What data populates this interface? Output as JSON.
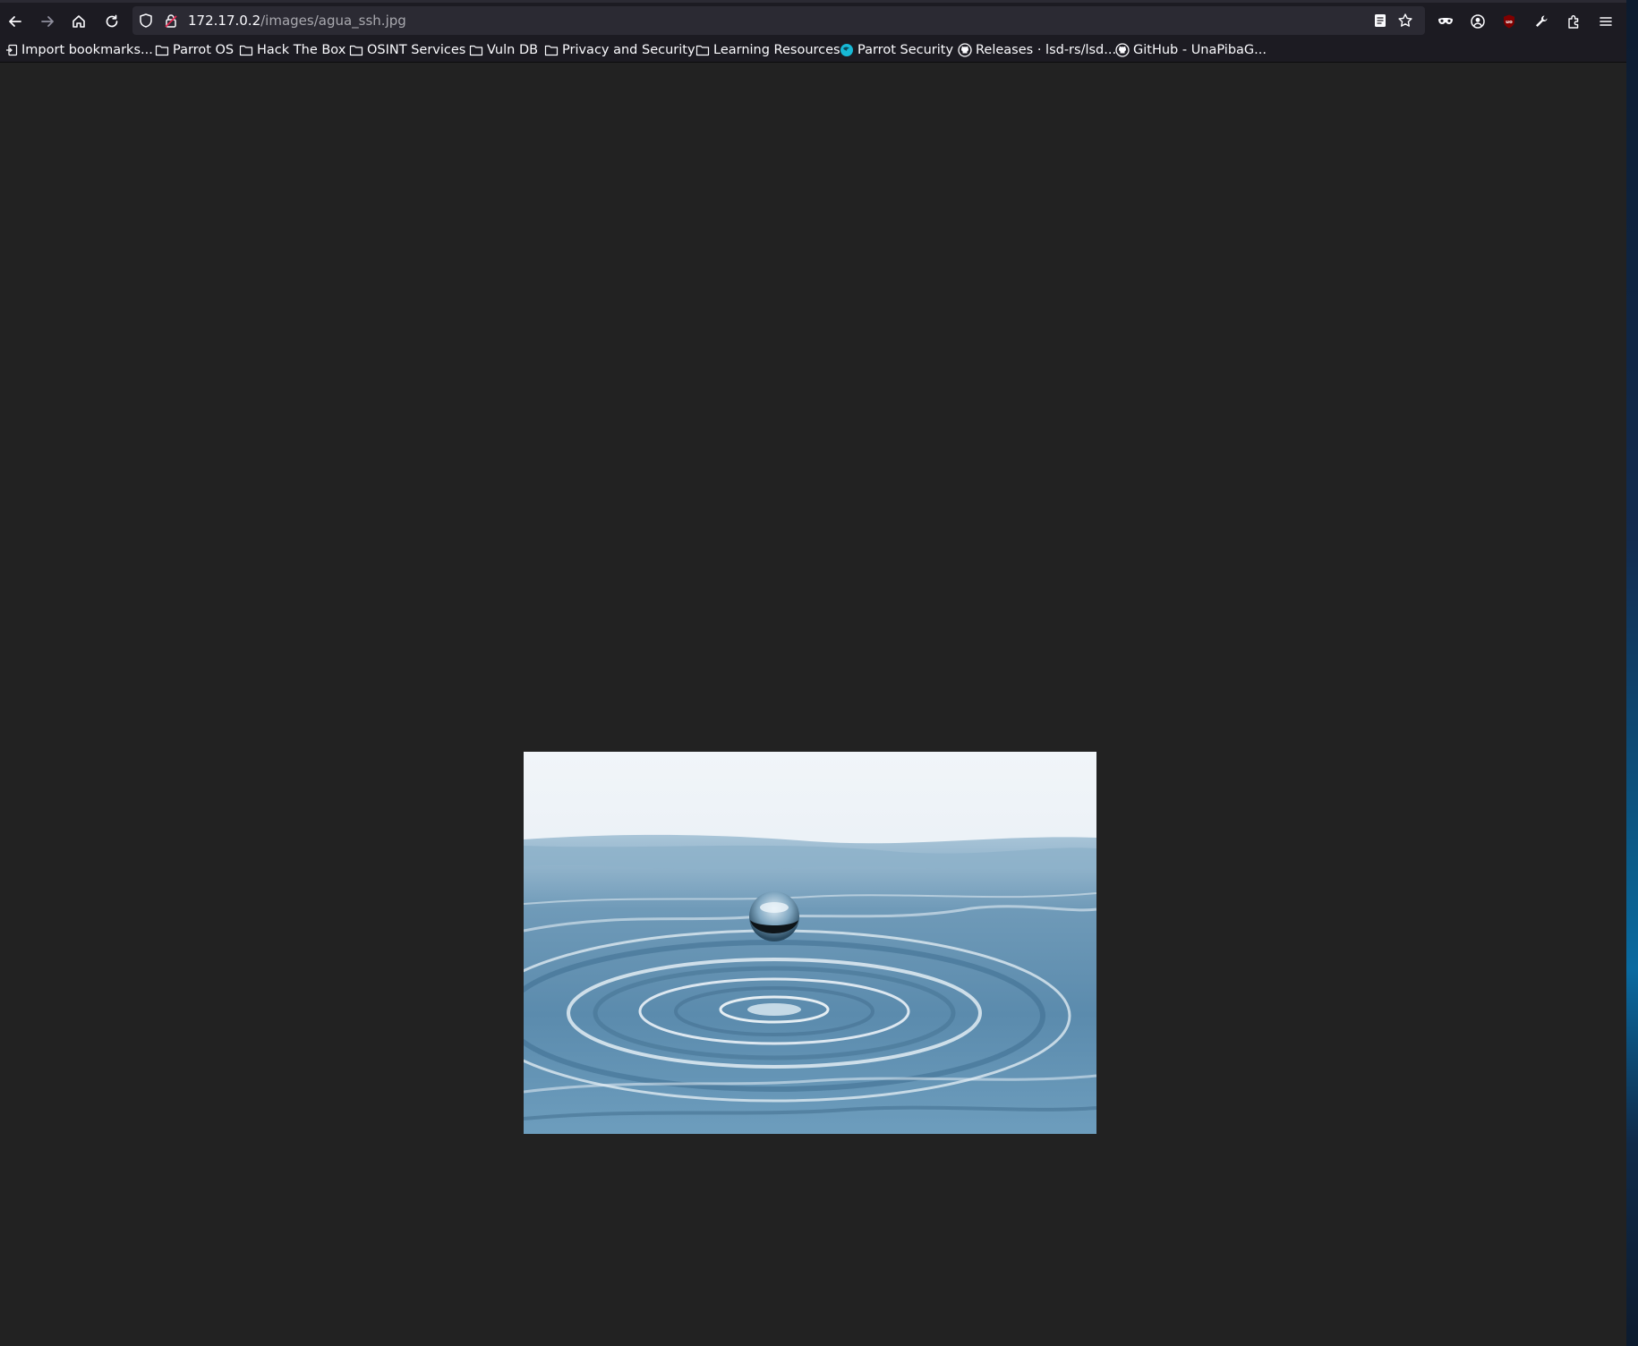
{
  "window": {
    "url_host": "172.17.0.2",
    "url_path": "/images/agua_ssh.jpg"
  },
  "toolbar": {
    "left_buttons": [
      "back-arrow-icon",
      "forward-arrow-icon",
      "home-icon",
      "reload-icon"
    ],
    "url_icons": [
      "shield-icon",
      "lock-warning-icon"
    ],
    "url_right_icons": [
      "reader-view-icon",
      "bookmark-star-icon"
    ],
    "right_buttons": [
      "private-mask-icon",
      "account-icon",
      "ublock-icon",
      "devtools-wrench-icon",
      "extensions-icon",
      "menu-icon"
    ]
  },
  "bookmarks": [
    {
      "label": "Import bookmarks...",
      "icon": "import-icon"
    },
    {
      "label": "Parrot OS",
      "icon": "folder-icon"
    },
    {
      "label": "Hack The Box",
      "icon": "folder-icon"
    },
    {
      "label": "OSINT Services",
      "icon": "folder-icon"
    },
    {
      "label": "Vuln DB",
      "icon": "folder-icon"
    },
    {
      "label": "Privacy and Security",
      "icon": "folder-icon"
    },
    {
      "label": "Learning Resources",
      "icon": "folder-icon"
    },
    {
      "label": "Parrot Security",
      "icon": "parrot-globe-icon"
    },
    {
      "label": "Releases · lsd-rs/lsd...",
      "icon": "github-icon"
    },
    {
      "label": "GitHub - UnaPibaG...",
      "icon": "github-icon"
    }
  ],
  "colors": {
    "toolbar_bg": "#1c1b22",
    "urlbar_bg": "#2b2a33",
    "page_bg": "#222222",
    "text": "#fbfbfe",
    "muted_text": "#a8a8ae",
    "water_light": "#e9f0f6",
    "water_mid": "#7fa8c4",
    "water_dark": "#3f6f90"
  },
  "content": {
    "image_subject": "water-droplet-photo"
  }
}
